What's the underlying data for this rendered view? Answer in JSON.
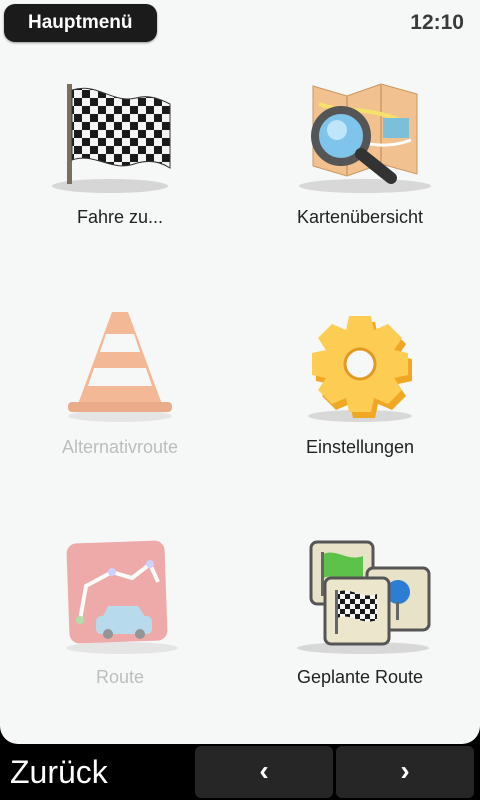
{
  "header": {
    "title": "Hauptmenü",
    "time": "12:10"
  },
  "menu": [
    {
      "label": "Fahre zu...",
      "icon": "checkered-flag-icon",
      "enabled": true
    },
    {
      "label": "Kartenübersicht",
      "icon": "map-magnifier-icon",
      "enabled": true
    },
    {
      "label": "Alternativroute",
      "icon": "traffic-cone-icon",
      "enabled": false
    },
    {
      "label": "Einstellungen",
      "icon": "gear-icon",
      "enabled": true
    },
    {
      "label": "Route",
      "icon": "route-car-icon",
      "enabled": false
    },
    {
      "label": "Geplante Route",
      "icon": "planned-route-icon",
      "enabled": true
    }
  ],
  "footer": {
    "back_label": "Zurück",
    "prev_symbol": "‹",
    "next_symbol": "›"
  }
}
